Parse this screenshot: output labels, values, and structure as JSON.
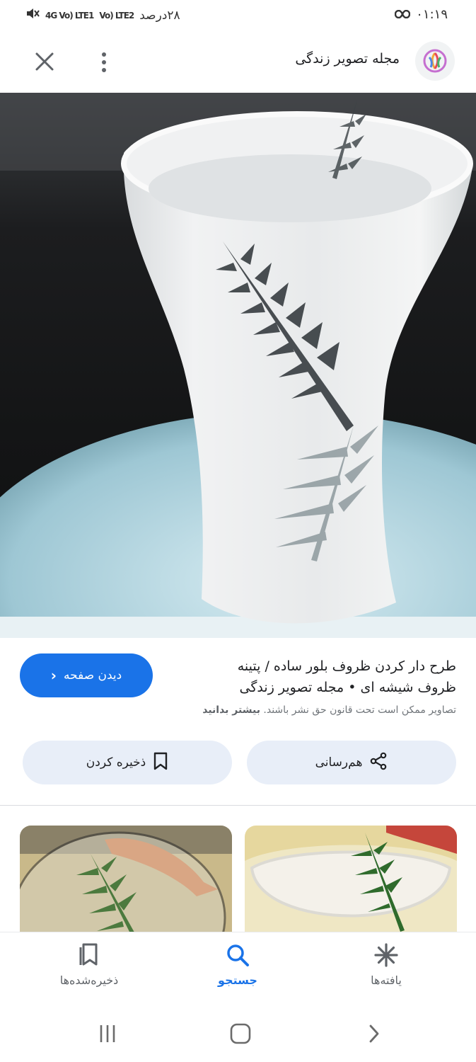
{
  "status_bar": {
    "time": "۰۱:۱۹",
    "battery": "۲۸درصد",
    "network_1": "Vo) LTE2",
    "network_2": "4G Vo) LTE1"
  },
  "header": {
    "site_name": "مجله تصویر زندگی"
  },
  "result": {
    "title": "طرح دار کردن ظروف بلور ساده / پتینه ظروف شیشه ای • مجله تصویر زندگی",
    "copyright_text": "تصاویر ممکن است تحت قانون حق نشر باشند.",
    "learn_more": "بیشتر بدانید",
    "visit_label": "دیدن صفحه"
  },
  "actions": {
    "share_label": "هم‌رسانی",
    "save_label": "ذخیره کردن"
  },
  "bottom_nav": {
    "saved_label": "ذخیره‌شده‌ها",
    "search_label": "جستجو",
    "discover_label": "یافته‌ها"
  },
  "colors": {
    "accent": "#1a73e8",
    "chip_bg": "#e8eef8"
  },
  "icons": [
    "close-icon",
    "more-vert-icon",
    "site-logo-icon",
    "chevron-left-icon",
    "share-icon",
    "bookmark-icon",
    "saved-icon",
    "search-icon",
    "discover-icon",
    "recents-icon",
    "home-icon",
    "back-icon"
  ]
}
